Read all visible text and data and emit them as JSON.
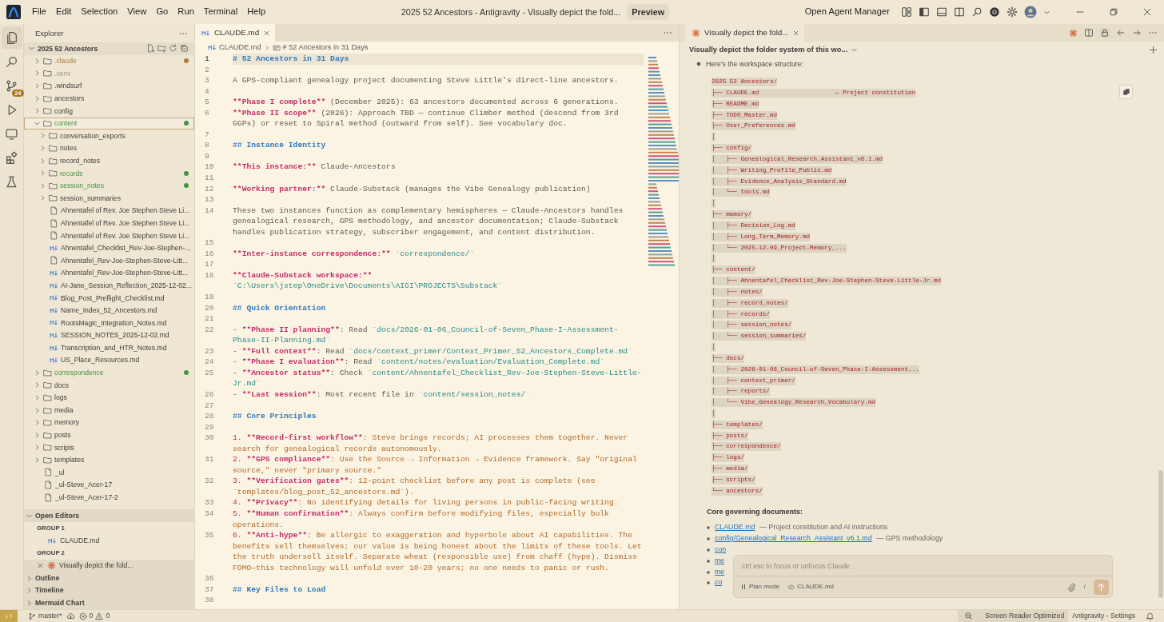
{
  "window": {
    "title": "2025 52 Ancestors - Antigravity - Visually depict the fold...",
    "preview_button": "Preview",
    "agent_manager": "Open Agent Manager"
  },
  "menu": [
    "File",
    "Edit",
    "Selection",
    "View",
    "Go",
    "Run",
    "Terminal",
    "Help"
  ],
  "activity_bar": [
    {
      "kind": "explorer",
      "selected": true
    },
    {
      "kind": "search",
      "selected": false
    },
    {
      "kind": "source_control",
      "selected": false,
      "badge": "24"
    },
    {
      "kind": "run",
      "selected": false
    },
    {
      "kind": "remote",
      "selected": false
    },
    {
      "kind": "extensions",
      "selected": false
    },
    {
      "kind": "testing",
      "selected": false
    }
  ],
  "sidebar": {
    "title": "Explorer",
    "tree": {
      "label": "2025 52 Ancestors",
      "expanded": true,
      "children": [
        {
          "label": ".claude",
          "kind": "folder",
          "expanded": false,
          "selected": false,
          "color": "#b07a3a",
          "dot": true
        },
        {
          "label": ".venv",
          "kind": "folder",
          "expanded": false,
          "selected": false,
          "color": "#9c978e",
          "dot": false
        },
        {
          "label": ".windsurf",
          "kind": "folder",
          "expanded": false,
          "selected": false
        },
        {
          "label": "ancestors",
          "kind": "folder",
          "expanded": false,
          "selected": false
        },
        {
          "label": "config",
          "kind": "folder",
          "expanded": false,
          "selected": false
        },
        {
          "label": "content",
          "kind": "folder",
          "expanded": true,
          "selected": true,
          "color": "#479243",
          "dot": true,
          "children": [
            {
              "label": "conversation_exports",
              "kind": "folder",
              "expanded": false,
              "selected": false
            },
            {
              "label": "notes",
              "kind": "folder",
              "expanded": false,
              "selected": false
            },
            {
              "label": "record_notes",
              "kind": "folder",
              "expanded": false,
              "selected": false
            },
            {
              "label": "records",
              "kind": "folder",
              "expanded": false,
              "selected": false,
              "color": "#479243",
              "dot": true
            },
            {
              "label": "session_notes",
              "kind": "folder",
              "expanded": false,
              "selected": false,
              "color": "#479243",
              "dot": true
            },
            {
              "label": "session_summaries",
              "kind": "folder",
              "expanded": false,
              "selected": false
            },
            {
              "label": "Ahnentafel of Rev. Joe Stephen Steve Li...",
              "kind": "file",
              "selected": false
            },
            {
              "label": "Ahnentafel of Rev. Joe Stephen Steve Li...",
              "kind": "file",
              "selected": false
            },
            {
              "label": "Ahnentafel of Rev. Joe Stephen Steve Li...",
              "kind": "file",
              "selected": false
            },
            {
              "label": "Ahnentafel_Checklist_Rev-Joe-Stephen-...",
              "kind": "markdown",
              "selected": false
            },
            {
              "label": "Ahnentafel_Rev-Joe-Stephen-Steve-Litt...",
              "kind": "file",
              "selected": false
            },
            {
              "label": "Ahnentafel_Rev-Joe-Stephen-Steve-Litt...",
              "kind": "markdown",
              "selected": false
            },
            {
              "label": "AI-Jane_Session_Reflection_2025-12-02...",
              "kind": "markdown",
              "selected": false
            },
            {
              "label": "Blog_Post_Preflight_Checklist.md",
              "kind": "markdown",
              "selected": false
            },
            {
              "label": "Name_Index_52_Ancestors.md",
              "kind": "markdown",
              "selected": false
            },
            {
              "label": "RootsMagic_Integration_Notes.md",
              "kind": "markdown",
              "selected": false
            },
            {
              "label": "SESSION_NOTES_2025-12-02.md",
              "kind": "markdown",
              "selected": false
            },
            {
              "label": "Transcription_and_HTR_Notes.md",
              "kind": "markdown",
              "selected": false
            },
            {
              "label": "US_Place_Resources.md",
              "kind": "markdown",
              "selected": false
            }
          ]
        },
        {
          "label": "correspondence",
          "kind": "folder",
          "expanded": false,
          "selected": false,
          "color": "#479243",
          "dot": true
        },
        {
          "label": "docs",
          "kind": "folder",
          "expanded": false,
          "selected": false
        },
        {
          "label": "logs",
          "kind": "folder",
          "expanded": false,
          "selected": false
        },
        {
          "label": "media",
          "kind": "folder",
          "expanded": false,
          "selected": false
        },
        {
          "label": "memory",
          "kind": "folder",
          "expanded": false,
          "selected": false
        },
        {
          "label": "posts",
          "kind": "folder",
          "expanded": false,
          "selected": false
        },
        {
          "label": "scripts",
          "kind": "folder",
          "expanded": false,
          "selected": false
        },
        {
          "label": "templates",
          "kind": "folder",
          "expanded": false,
          "selected": false
        },
        {
          "label": "_ul",
          "kind": "file",
          "selected": false
        },
        {
          "label": "_ul-Steve_Acer-17",
          "kind": "file",
          "selected": false
        },
        {
          "label": "_ul-Steve_Acer-17-2",
          "kind": "file",
          "selected": false
        }
      ]
    },
    "open_editors": {
      "title": "Open Editors",
      "expanded": true,
      "groups": [
        {
          "label": "GROUP 1",
          "items": [
            {
              "label": "CLAUDE.md",
              "kind": "markdown",
              "selected": false
            }
          ]
        },
        {
          "label": "GROUP 2",
          "items": [
            {
              "label": "Visually depict the fold...",
              "kind": "agent",
              "selected": true
            }
          ]
        }
      ]
    },
    "sections": [
      {
        "title": "Outline",
        "expanded": false
      },
      {
        "title": "Timeline",
        "expanded": false
      },
      {
        "title": "Mermaid Chart",
        "expanded": false
      }
    ]
  },
  "editor": {
    "tab": {
      "label": "CLAUDE.md",
      "selected": true
    },
    "breadcrumb": [
      "CLAUDE.md",
      "# 52 Ancestors in 31 Days"
    ],
    "lines": [
      {
        "number": "1",
        "current": true,
        "segments": [
          {
            "kind": "heading",
            "text": "# 52 Ancestors in 31 Days"
          }
        ]
      },
      {
        "number": "2",
        "current": false
      },
      {
        "number": "3",
        "current": false,
        "segments": [
          {
            "kind": "plain",
            "text": "A GPS-compliant genealogy project documenting Steve Little's direct-line ancestors."
          }
        ]
      },
      {
        "number": "4",
        "current": false
      },
      {
        "number": "5",
        "current": false,
        "segments": [
          {
            "kind": "bold",
            "text": "**Phase I complete**"
          },
          {
            "kind": "plain",
            "text": " (December 2025): 63 ancestors documented across 6 generations."
          }
        ]
      },
      {
        "number": "6",
        "current": false,
        "segments": [
          {
            "kind": "bold",
            "text": "**Phase II scope**"
          },
          {
            "kind": "plain",
            "text": " (2026): Approach TBD — continue Climber method (descend from 3rd GGPs) or reset to Spiral method (outward from self). See vocabulary doc."
          }
        ]
      },
      {
        "number": "7",
        "current": false
      },
      {
        "number": "8",
        "current": false,
        "segments": [
          {
            "kind": "heading",
            "text": "## Instance Identity"
          }
        ]
      },
      {
        "number": "9",
        "current": false
      },
      {
        "number": "10",
        "current": false,
        "segments": [
          {
            "kind": "bold",
            "text": "**This instance:**"
          },
          {
            "kind": "plain",
            "text": " Claude-Ancestors"
          }
        ]
      },
      {
        "number": "11",
        "current": false
      },
      {
        "number": "12",
        "current": false,
        "segments": [
          {
            "kind": "bold",
            "text": "**Working partner:**"
          },
          {
            "kind": "plain",
            "text": " Claude-Substack (manages the Vibe Genealogy publication)"
          }
        ]
      },
      {
        "number": "13",
        "current": false
      },
      {
        "number": "14",
        "current": false,
        "segments": [
          {
            "kind": "plain",
            "text": "These two instances function as complementary hemispheres — Claude-Ancestors handles genealogical research, GPS methodology, and ancestor documentation; Claude-Substack handles publication strategy, subscriber engagement, and content distribution."
          }
        ]
      },
      {
        "number": "15",
        "current": false
      },
      {
        "number": "16",
        "current": false,
        "segments": [
          {
            "kind": "bold",
            "text": "**Inter-instance correspondence:**"
          },
          {
            "kind": "code",
            "text": " `correspondence/`"
          }
        ]
      },
      {
        "number": "17",
        "current": false
      },
      {
        "number": "18",
        "current": false,
        "segments": [
          {
            "kind": "bold",
            "text": "**Claude-Substack workspace:**"
          },
          {
            "kind": "code",
            "text": " `C:\\Users\\jstep\\OneDrive\\Documents\\AIGI\\PROJECTS\\Substack`"
          }
        ]
      },
      {
        "number": "19",
        "current": false
      },
      {
        "number": "20",
        "current": false,
        "segments": [
          {
            "kind": "heading",
            "text": "## Quick Orientation"
          }
        ]
      },
      {
        "number": "21",
        "current": false
      },
      {
        "number": "22",
        "current": false,
        "segments": [
          {
            "kind": "marker",
            "text": "- "
          },
          {
            "kind": "bold",
            "text": "**Phase II planning**"
          },
          {
            "kind": "plain",
            "text": ": Read "
          },
          {
            "kind": "code",
            "text": "`docs/2026-01-06_Council-of-Seven_Phase-I-Assessment-Phase-II-Planning.md`"
          }
        ]
      },
      {
        "number": "23",
        "current": false,
        "segments": [
          {
            "kind": "marker",
            "text": "- "
          },
          {
            "kind": "bold",
            "text": "**Full context**"
          },
          {
            "kind": "plain",
            "text": ": Read "
          },
          {
            "kind": "code",
            "text": "`docs/context_primer/Context_Primer_52_Ancestors_Complete.md`"
          }
        ]
      },
      {
        "number": "24",
        "current": false,
        "segments": [
          {
            "kind": "marker",
            "text": "- "
          },
          {
            "kind": "bold",
            "text": "**Phase I evaluation**"
          },
          {
            "kind": "plain",
            "text": ": Read "
          },
          {
            "kind": "code",
            "text": "`content/notes/evaluation/Evaluation_Complete.md`"
          }
        ]
      },
      {
        "number": "25",
        "current": false,
        "segments": [
          {
            "kind": "marker",
            "text": "- "
          },
          {
            "kind": "bold",
            "text": "**Ancestor status**"
          },
          {
            "kind": "plain",
            "text": ": Check "
          },
          {
            "kind": "code",
            "text": "`content/Ahnentafel_Checklist_Rev-Joe-Stephen-Steve-Little-Jr.md`"
          }
        ]
      },
      {
        "number": "26",
        "current": false,
        "segments": [
          {
            "kind": "marker",
            "text": "- "
          },
          {
            "kind": "bold",
            "text": "**Last session**"
          },
          {
            "kind": "plain",
            "text": ": Most recent file in "
          },
          {
            "kind": "code",
            "text": "`content/session_notes/`"
          }
        ]
      },
      {
        "number": "27",
        "current": false
      },
      {
        "number": "28",
        "current": false,
        "segments": [
          {
            "kind": "heading",
            "text": "## Core Principles"
          }
        ]
      },
      {
        "number": "29",
        "current": false
      },
      {
        "number": "30",
        "current": false,
        "segments": [
          {
            "kind": "marker",
            "text": "1. "
          },
          {
            "kind": "bold",
            "text": "**Record-first workflow**"
          },
          {
            "kind": "item",
            "text": ": Steve brings records; AI processes them together. Never search for genealogical records autonomously."
          }
        ]
      },
      {
        "number": "31",
        "current": false,
        "segments": [
          {
            "kind": "marker",
            "text": "2. "
          },
          {
            "kind": "bold",
            "text": "**GPS compliance**"
          },
          {
            "kind": "item",
            "text": ": Use the Source → Information → Evidence framework. Say \"original source,\" never \"primary source.\""
          }
        ]
      },
      {
        "number": "32",
        "current": false,
        "segments": [
          {
            "kind": "marker",
            "text": "3. "
          },
          {
            "kind": "bold",
            "text": "**Verification gates**"
          },
          {
            "kind": "item",
            "text": ": 12-point checklist before any post is complete (see `templates/blog_post_52_ancestors.md`)."
          }
        ]
      },
      {
        "number": "33",
        "current": false,
        "segments": [
          {
            "kind": "marker",
            "text": "4. "
          },
          {
            "kind": "bold",
            "text": "**Privacy**"
          },
          {
            "kind": "item",
            "text": ": No identifying details for living persons in public-facing writing."
          }
        ]
      },
      {
        "number": "34",
        "current": false,
        "segments": [
          {
            "kind": "marker",
            "text": "5. "
          },
          {
            "kind": "bold",
            "text": "**Human confirmation**"
          },
          {
            "kind": "item",
            "text": ": Always confirm before modifying files, especially bulk operations."
          }
        ]
      },
      {
        "number": "35",
        "current": false,
        "segments": [
          {
            "kind": "marker",
            "text": "6. "
          },
          {
            "kind": "bold",
            "text": "**Anti-hype**"
          },
          {
            "kind": "item",
            "text": ": Be allergic to exaggeration and hyperbole about AI capabilities. The benefits sell themselves; our value is being honest about the limits of these tools. Let the truth undersell itself. Separate wheat (responsible use) from chaff (hype). Dismiss FOMO—this technology will unfold over 10-20 years; no one needs to panic or rush."
          }
        ]
      },
      {
        "number": "36",
        "current": false
      },
      {
        "number": "37",
        "current": false,
        "segments": [
          {
            "kind": "heading",
            "text": "## Key Files to Load"
          }
        ]
      },
      {
        "number": "38",
        "current": false
      }
    ]
  },
  "agent_panel": {
    "tab": {
      "label": "Visually depict the fold...",
      "selected": true
    },
    "conversation_title": "Visually depict the folder system of this wo...",
    "intro": "Here's the workspace structure:",
    "tree_lines": [
      {
        "text": "2025 52 Ancestors/"
      },
      {
        "text": "├── CLAUDE.md",
        "note": "← Project constitution"
      },
      {
        "text": "├── README.md"
      },
      {
        "text": "├── TODO_Master.md"
      },
      {
        "text": "├── User_Preferences.md"
      },
      {
        "text": "│"
      },
      {
        "text": "├── config/"
      },
      {
        "text": "│   ├── Genealogical_Research_Assistant_v6.1.md"
      },
      {
        "text": "│   ├── Writing_Profile_Public.md"
      },
      {
        "text": "│   ├── Evidence_Analysis_Standard.md"
      },
      {
        "text": "│   └── tools.md"
      },
      {
        "text": "│"
      },
      {
        "text": "├── memory/"
      },
      {
        "text": "│   ├── Decision_Log.md"
      },
      {
        "text": "│   ├── Long_Term_Memory.md"
      },
      {
        "text": "│   └── 2025-12-09_Project-Memory_..."
      },
      {
        "text": "│"
      },
      {
        "text": "├── content/"
      },
      {
        "text": "│   ├── Ahnentafel_Checklist_Rev-Joe-Stephen-Steve-Little-Jr.md"
      },
      {
        "text": "│   ├── notes/"
      },
      {
        "text": "│   ├── record_notes/"
      },
      {
        "text": "│   ├── records/"
      },
      {
        "text": "│   ├── session_notes/"
      },
      {
        "text": "│   └── session_summaries/"
      },
      {
        "text": "│"
      },
      {
        "text": "├── docs/"
      },
      {
        "text": "│   ├── 2026-01-06_Council-of-Seven_Phase-I-Assessment..."
      },
      {
        "text": "│   ├── context_primer/"
      },
      {
        "text": "│   ├── reports/"
      },
      {
        "text": "│   └── Vibe_Genealogy_Research_Vocabulary.md"
      },
      {
        "text": "│"
      },
      {
        "text": "├── templates/"
      },
      {
        "text": "├── posts/"
      },
      {
        "text": "├── correspondence/"
      },
      {
        "text": "├── logs/"
      },
      {
        "text": "├── media/"
      },
      {
        "text": "├── scripts/"
      },
      {
        "text": "└── ancestors/"
      }
    ],
    "docs_heading": "Core governing documents:",
    "docs": [
      {
        "link": "CLAUDE.md",
        "description": "— Project constitution and AI instructions"
      },
      {
        "link": "config/Genealogical_Research_Assistant_v6.1.md",
        "description": "— GPS methodology"
      },
      {
        "link": "con"
      },
      {
        "link": "me"
      },
      {
        "link": "me"
      },
      {
        "link": "co"
      }
    ],
    "prompt": {
      "placeholder": "ctrl esc to focus or unfocus Claude",
      "mode": "Plan mode",
      "context_file": "CLAUDE.md",
      "slash": "/"
    }
  },
  "status_bar": {
    "branch": "master*",
    "errors": "0",
    "warnings": "0",
    "items": [
      {
        "label": "Screen Reader Optimized",
        "selected": true
      },
      {
        "label": "Antigravity - Settings",
        "selected": false
      }
    ]
  }
}
